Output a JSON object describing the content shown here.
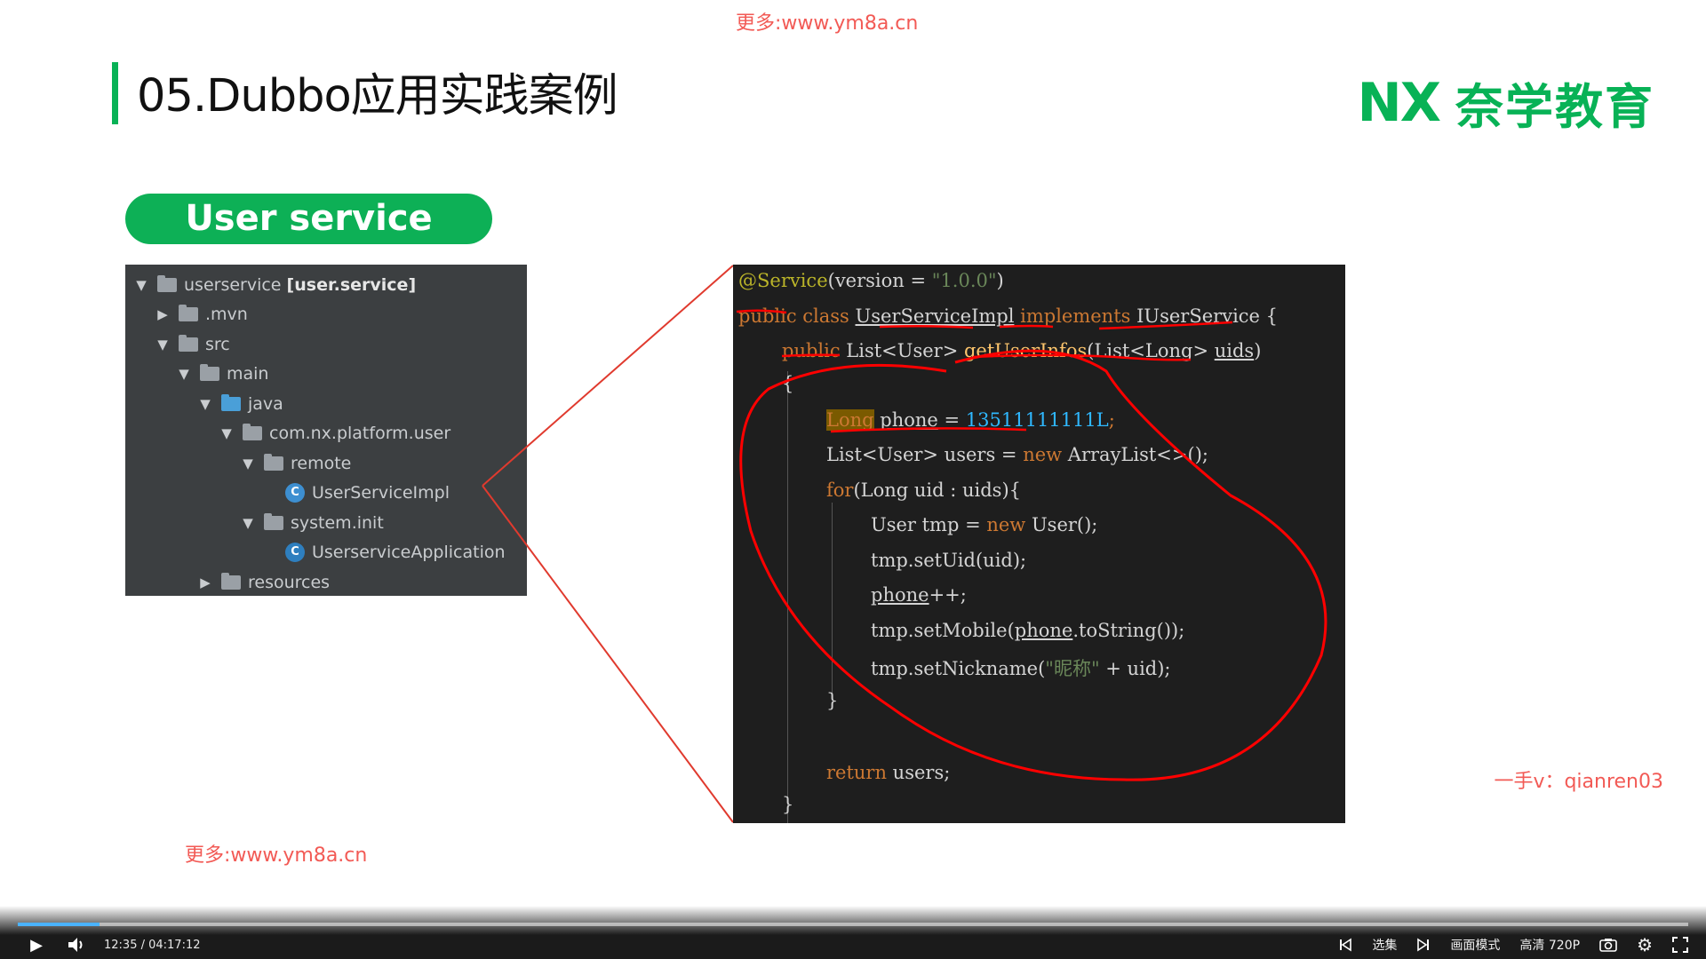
{
  "watermarks": {
    "top": "更多:www.ym8a.cn",
    "bottom": "更多:www.ym8a.cn",
    "right": "一手v：qianren03"
  },
  "slide": {
    "title": "05.Dubbo应用实践案例",
    "logo_nx": "NX",
    "logo_cn": "奈学教育",
    "pill": "User service"
  },
  "tree": [
    {
      "depth": 0,
      "arrow": "▼",
      "icon": "folder",
      "label": "userservice ",
      "bold": "[user.service]"
    },
    {
      "depth": 1,
      "arrow": "▶",
      "icon": "folder",
      "label": ".mvn"
    },
    {
      "depth": 1,
      "arrow": "▼",
      "icon": "folder",
      "label": "src"
    },
    {
      "depth": 2,
      "arrow": "▼",
      "icon": "folder",
      "label": "main"
    },
    {
      "depth": 3,
      "arrow": "▼",
      "icon": "folder-blue",
      "label": "java"
    },
    {
      "depth": 4,
      "arrow": "▼",
      "icon": "folder",
      "label": "com.nx.platform.user"
    },
    {
      "depth": 5,
      "arrow": "▼",
      "icon": "folder",
      "label": "remote"
    },
    {
      "depth": 6,
      "arrow": "",
      "icon": "class",
      "label": "UserServiceImpl"
    },
    {
      "depth": 5,
      "arrow": "▼",
      "icon": "folder",
      "label": "system.init"
    },
    {
      "depth": 6,
      "arrow": "",
      "icon": "class-app",
      "label": "UserserviceApplication"
    },
    {
      "depth": 3,
      "arrow": "▶",
      "icon": "folder",
      "label": "resources"
    }
  ],
  "code": {
    "annotation": "@Service",
    "version_key": "(version = ",
    "version_val": "\"1.0.0\"",
    "close_paren": ")",
    "public_class": "public class ",
    "class_name": "UserServiceImpl",
    "implements": " implements ",
    "iface": "IUserService {",
    "method_mod": "public ",
    "method_ret": "List<User> ",
    "method_name": "getUserInfos",
    "method_params": "(List<Long> ",
    "method_param_name": "uids",
    "method_close": ")",
    "open_brace": "{",
    "long_kw": "Long",
    "phone_var": "phone",
    "assign": " = ",
    "phone_num": "13511111111L",
    "semicolon": ";",
    "list_decl": "List<User> users = ",
    "new_kw": "new",
    "arraylist": " ArrayList<>();",
    "for_kw": "for",
    "for_body": "(Long uid : uids){",
    "user_tmp": "User tmp = ",
    "user_ctor": " User();",
    "set_uid": "tmp.setUid(uid);",
    "phone_inc": "++;",
    "set_mobile_a": "tmp.setMobile(",
    "set_mobile_b": ".toString());",
    "set_nick_a": "tmp.setNickname(",
    "nick_str": "\"昵称\"",
    "set_nick_b": " + uid);",
    "close_for": "}",
    "return_kw": "return",
    "return_val": " users;",
    "close_method": "}"
  },
  "player": {
    "time": "12:35 / 04:17:12",
    "progress": 0.049,
    "episodes": "选集",
    "mode": "画面模式",
    "quality": "高清 720P"
  },
  "colors": {
    "brand_green": "#08b256",
    "watermark_red": "#f25a55",
    "ink_red": "#ff0000"
  }
}
